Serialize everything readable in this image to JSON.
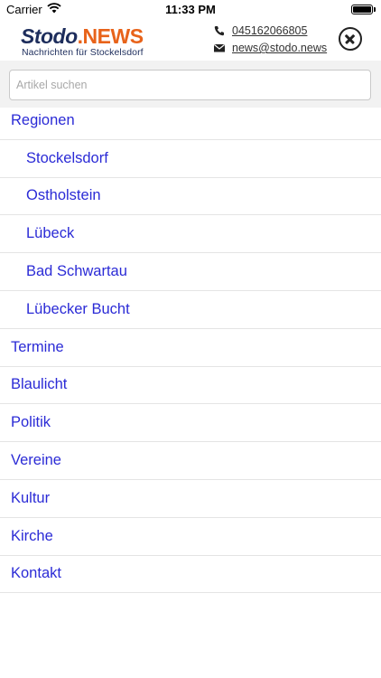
{
  "status_bar": {
    "carrier": "Carrier",
    "time": "11:33 PM",
    "battery_level": 1.0
  },
  "header": {
    "logo_stodo": "Stodo",
    "logo_news": ".NEWS",
    "tagline": "Nachrichten für Stockelsdorf",
    "phone": "045162066805",
    "email": "news@stodo.news",
    "phone_icon": "phone-icon",
    "mail_icon": "envelope-icon",
    "close_icon": "close-circle-icon"
  },
  "search": {
    "placeholder": "Artikel suchen",
    "value": ""
  },
  "menu": {
    "items": [
      {
        "label": "Regionen",
        "sub": false
      },
      {
        "label": "Stockelsdorf",
        "sub": true
      },
      {
        "label": "Ostholstein",
        "sub": true
      },
      {
        "label": "Lübeck",
        "sub": true
      },
      {
        "label": "Bad Schwartau",
        "sub": true
      },
      {
        "label": "Lübecker Bucht",
        "sub": true
      },
      {
        "label": "Termine",
        "sub": false
      },
      {
        "label": "Blaulicht",
        "sub": false
      },
      {
        "label": "Politik",
        "sub": false
      },
      {
        "label": "Vereine",
        "sub": false
      },
      {
        "label": "Kultur",
        "sub": false
      },
      {
        "label": "Kirche",
        "sub": false
      },
      {
        "label": "Kontakt",
        "sub": false
      }
    ]
  },
  "colors": {
    "link": "#2b2bd6",
    "brand_dark": "#1d2d5c",
    "brand_orange": "#e8631a",
    "search_bg": "#f2f2f2"
  }
}
